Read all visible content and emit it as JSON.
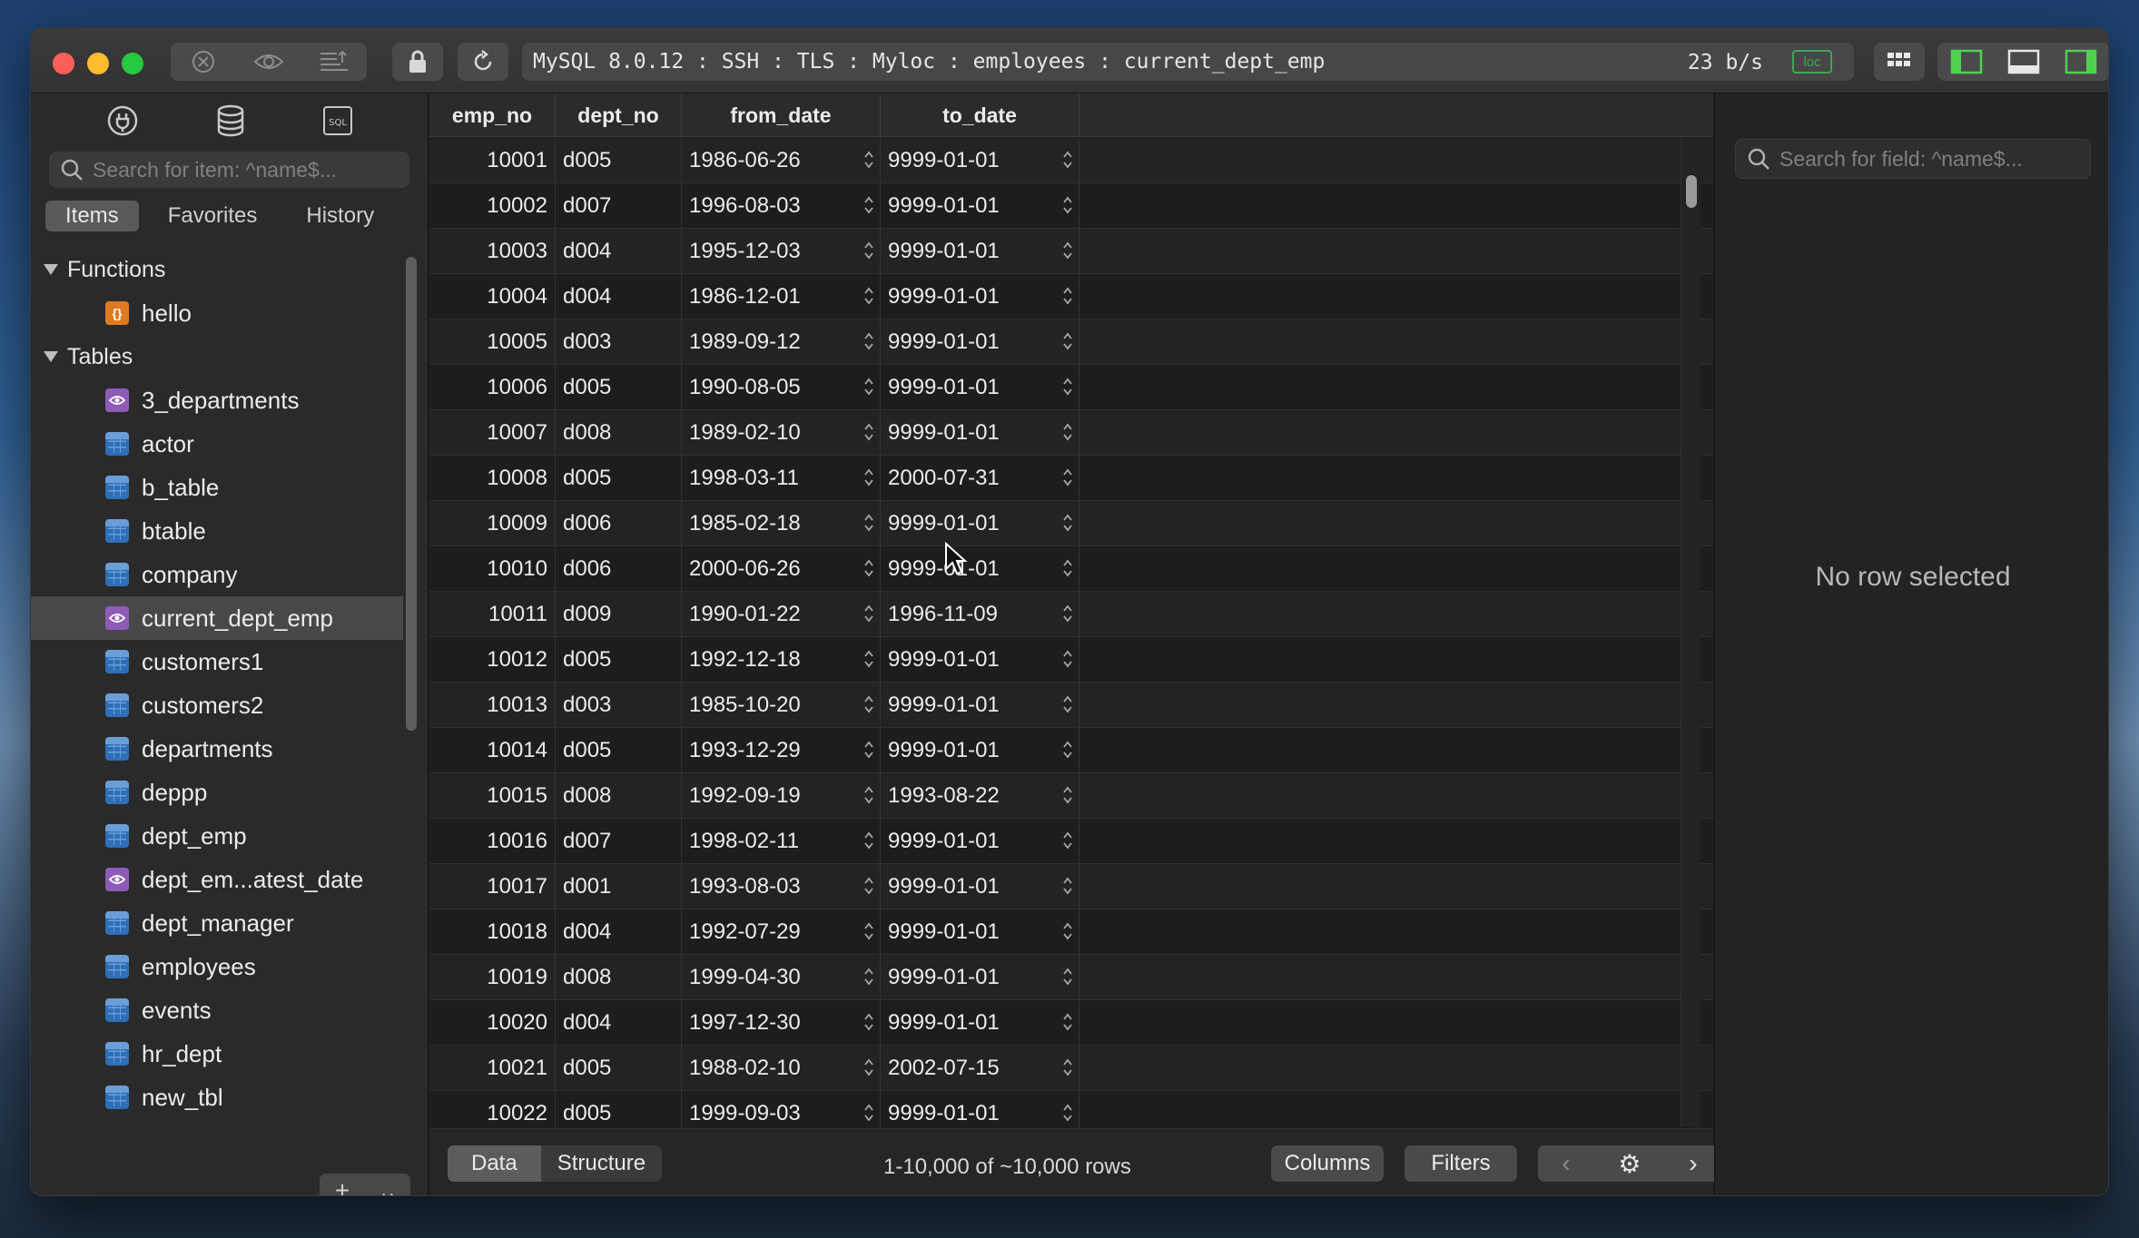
{
  "titlebar": {
    "connection": "MySQL 8.0.12 : SSH : TLS : Myloc : employees : current_dept_emp",
    "speed": "23 b/s",
    "loc_badge": "loc"
  },
  "sidebar": {
    "search_placeholder": "Search for item: ^name$...",
    "tabs": [
      "Items",
      "Favorites",
      "History"
    ],
    "groups": {
      "functions": "Functions",
      "tables": "Tables"
    },
    "functions": [
      "hello"
    ],
    "tables": [
      {
        "name": "3_departments",
        "kind": "view"
      },
      {
        "name": "actor",
        "kind": "table"
      },
      {
        "name": "b_table",
        "kind": "table"
      },
      {
        "name": "btable",
        "kind": "table"
      },
      {
        "name": "company",
        "kind": "table"
      },
      {
        "name": "current_dept_emp",
        "kind": "view",
        "selected": true
      },
      {
        "name": "customers1",
        "kind": "table"
      },
      {
        "name": "customers2",
        "kind": "table"
      },
      {
        "name": "departments",
        "kind": "table"
      },
      {
        "name": "deppp",
        "kind": "table"
      },
      {
        "name": "dept_emp",
        "kind": "table"
      },
      {
        "name": "dept_em...atest_date",
        "kind": "view"
      },
      {
        "name": "dept_manager",
        "kind": "table"
      },
      {
        "name": "employees",
        "kind": "table"
      },
      {
        "name": "events",
        "kind": "table"
      },
      {
        "name": "hr_dept",
        "kind": "table"
      },
      {
        "name": "new_tbl",
        "kind": "table"
      }
    ],
    "add_label": "+",
    "more_label": "⌄"
  },
  "table": {
    "columns": [
      "emp_no",
      "dept_no",
      "from_date",
      "to_date"
    ],
    "rows": [
      [
        "10001",
        "d005",
        "1986-06-26",
        "9999-01-01"
      ],
      [
        "10002",
        "d007",
        "1996-08-03",
        "9999-01-01"
      ],
      [
        "10003",
        "d004",
        "1995-12-03",
        "9999-01-01"
      ],
      [
        "10004",
        "d004",
        "1986-12-01",
        "9999-01-01"
      ],
      [
        "10005",
        "d003",
        "1989-09-12",
        "9999-01-01"
      ],
      [
        "10006",
        "d005",
        "1990-08-05",
        "9999-01-01"
      ],
      [
        "10007",
        "d008",
        "1989-02-10",
        "9999-01-01"
      ],
      [
        "10008",
        "d005",
        "1998-03-11",
        "2000-07-31"
      ],
      [
        "10009",
        "d006",
        "1985-02-18",
        "9999-01-01"
      ],
      [
        "10010",
        "d006",
        "2000-06-26",
        "9999-01-01"
      ],
      [
        "10011",
        "d009",
        "1990-01-22",
        "1996-11-09"
      ],
      [
        "10012",
        "d005",
        "1992-12-18",
        "9999-01-01"
      ],
      [
        "10013",
        "d003",
        "1985-10-20",
        "9999-01-01"
      ],
      [
        "10014",
        "d005",
        "1993-12-29",
        "9999-01-01"
      ],
      [
        "10015",
        "d008",
        "1992-09-19",
        "1993-08-22"
      ],
      [
        "10016",
        "d007",
        "1998-02-11",
        "9999-01-01"
      ],
      [
        "10017",
        "d001",
        "1993-08-03",
        "9999-01-01"
      ],
      [
        "10018",
        "d004",
        "1992-07-29",
        "9999-01-01"
      ],
      [
        "10019",
        "d008",
        "1999-04-30",
        "9999-01-01"
      ],
      [
        "10020",
        "d004",
        "1997-12-30",
        "9999-01-01"
      ],
      [
        "10021",
        "d005",
        "1988-02-10",
        "2002-07-15"
      ],
      [
        "10022",
        "d005",
        "1999-09-03",
        "9999-01-01"
      ]
    ]
  },
  "footer": {
    "data_tab": "Data",
    "structure_tab": "Structure",
    "row_count": "1-10,000 of ~10,000 rows",
    "columns_btn": "Columns",
    "filters_btn": "Filters",
    "prev": "‹",
    "settings": "⚙",
    "next": "›"
  },
  "detail": {
    "search_placeholder": "Search for field: ^name$...",
    "empty_text": "No row selected"
  },
  "colors": {
    "traffic_red": "#ff5f57",
    "traffic_yellow": "#febc2e",
    "traffic_green": "#28c840",
    "loc_green": "#3ea84f",
    "view_purple": "#8e5bb8",
    "table_blue": "#2e6fb8",
    "function_orange": "#e07a1f"
  }
}
